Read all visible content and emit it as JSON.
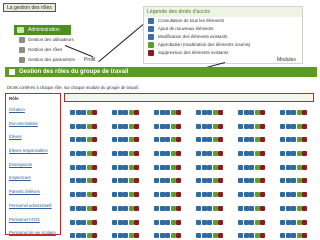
{
  "breadcrumb": "La gestion des rôles",
  "admin_menu": {
    "title": "Administration",
    "items": [
      "Gestion des utilisateurs",
      "Gestion des rôles",
      "Gestion des paramètres"
    ]
  },
  "legend": {
    "title": "Légende des droits d'accès",
    "items": [
      "Consultation de tous les éléments",
      "Ajout de nouveaux éléments",
      "Modification des éléments existants",
      "Approbation (modération des éléments soumis)",
      "Suppression des éléments existants"
    ]
  },
  "labels": {
    "profil": "Profil",
    "modules": "Modules"
  },
  "section_title": "Gestion des rôles du groupe de travail",
  "intro": "Droits conférés à chaque rôle, sur chaque module du groupe de travail :",
  "roles_header": "Rôle",
  "roles": [
    "Création",
    "Documentaliste",
    "Élèves",
    "Élèves responsables",
    "Enseignants",
    "Inspecteurs",
    "Parents d'élèves",
    "Personnel administratif",
    "Personnel ATOS",
    "Personnel de vie scolaire"
  ],
  "module_headers": [
    "",
    "",
    "",
    "",
    "",
    ""
  ],
  "colors": {
    "accent": "#5a9b22",
    "highlight": "#c62828",
    "link": "#2f5f9f"
  }
}
